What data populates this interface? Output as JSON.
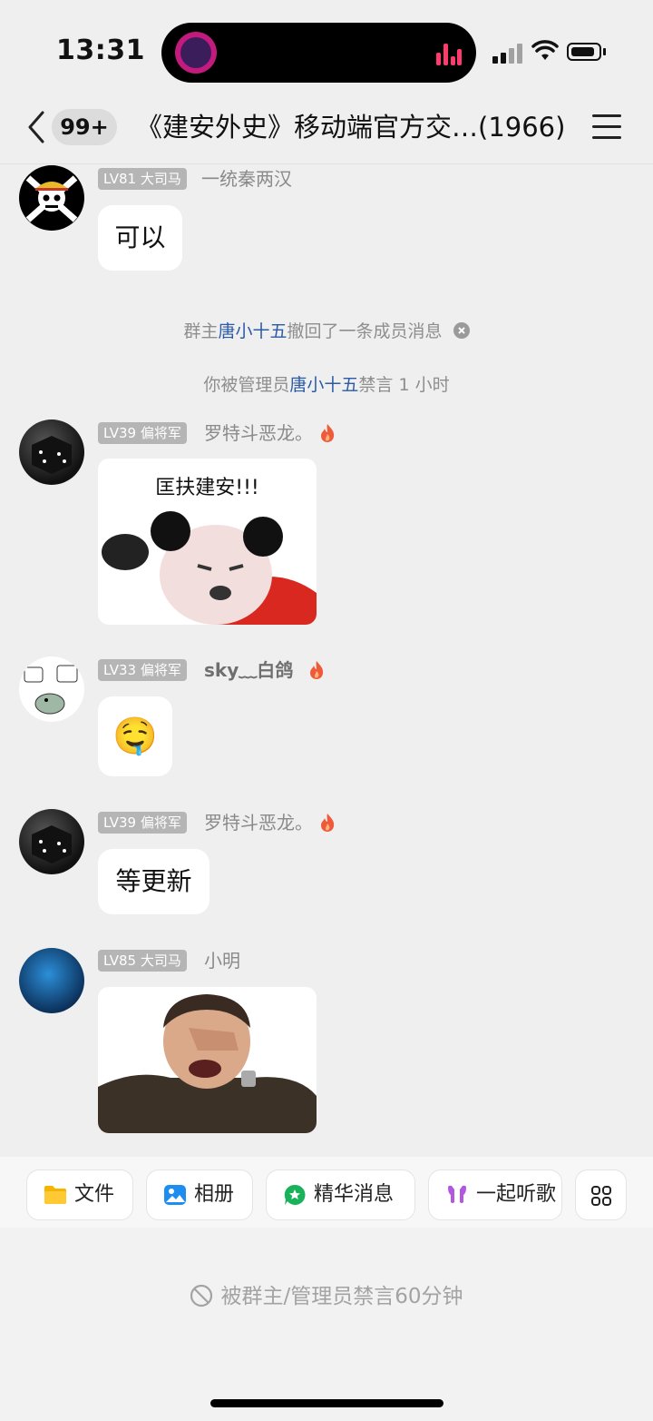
{
  "status_bar": {
    "time": "13:31"
  },
  "header": {
    "unread_badge": "99+",
    "group_title": "《建安外史》移动端官方交…(1966)"
  },
  "messages": [
    {
      "level": "LV81 大司马",
      "name": "一统秦两汉",
      "text": "可以"
    },
    {
      "level": "LV39 偏将军",
      "name": "罗特斗恶龙。",
      "sticker_caption": "匡扶建安!!!"
    },
    {
      "level": "LV33 偏将军",
      "name": "sky﹏白鸽",
      "emoji": "🤤"
    },
    {
      "level": "LV39 偏将军",
      "name": "罗特斗恶龙。",
      "text": "等更新"
    },
    {
      "level": "LV85 大司马",
      "name": "小明"
    }
  ],
  "system_notices": [
    {
      "prefix": "群主",
      "name": "唐小十五",
      "suffix": "撤回了一条成员消息"
    },
    {
      "prefix": "你被管理员",
      "name": "唐小十五",
      "suffix": "禁言 1 小时"
    }
  ],
  "toolbar": {
    "items": [
      {
        "label": "文件",
        "icon": "folder-icon"
      },
      {
        "label": "相册",
        "icon": "photo-album-icon"
      },
      {
        "label": "精华消息",
        "icon": "featured-message-icon"
      },
      {
        "label": "一起听歌",
        "icon": "headphones-icon"
      }
    ],
    "more_icon": "grid-more-icon"
  },
  "input": {
    "muted_text": "被群主/管理员禁言60分钟"
  },
  "colors": {
    "background": "#efefef",
    "link_blue": "#2b5aa7",
    "level_badge": "#b5b5b5",
    "island_bars": "#ff3b6e"
  }
}
